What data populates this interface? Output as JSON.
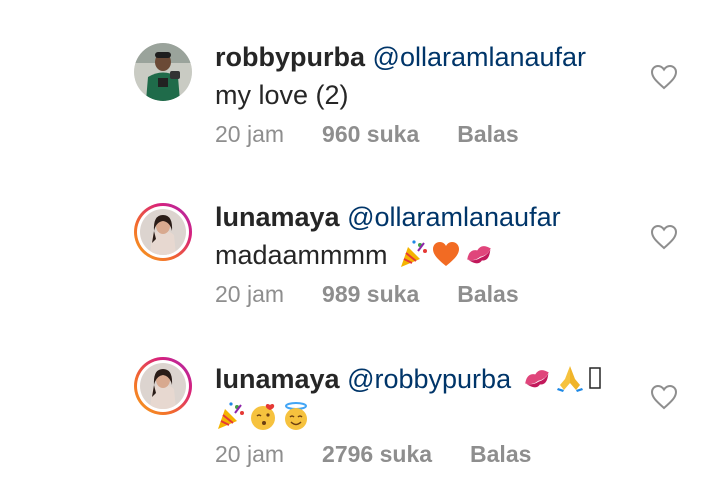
{
  "comments": [
    {
      "username": "robbypurba",
      "mention": "@ollaramlanaufar",
      "text": "my love (2)",
      "time": "20 jam",
      "likes": "960 suka",
      "reply": "Balas"
    },
    {
      "username": "lunamaya",
      "mention": "@ollaramlanaufar",
      "text": "madaammmm",
      "time": "20 jam",
      "likes": "989 suka",
      "reply": "Balas"
    },
    {
      "username": "lunamaya",
      "mention": "@robbypurba",
      "text": "",
      "time": "20 jam",
      "likes": "2796 suka",
      "reply": "Balas"
    }
  ],
  "icons": {
    "like": "heart-outline-icon",
    "emoji_party": "party-popper-emoji",
    "emoji_heart": "orange-heart-emoji",
    "emoji_kiss": "kiss-mark-emoji",
    "emoji_pray": "folded-hands-emoji",
    "emoji_kissing_face": "face-blowing-kiss-emoji",
    "emoji_halo": "smiling-face-with-halo-emoji"
  },
  "colors": {
    "username": "#262626",
    "mention": "#003569",
    "meta": "#8e8e8e",
    "heart_outline": "#8e8e8e",
    "story_ring_start": "#f7a31c",
    "story_ring_end": "#a42cb4"
  }
}
